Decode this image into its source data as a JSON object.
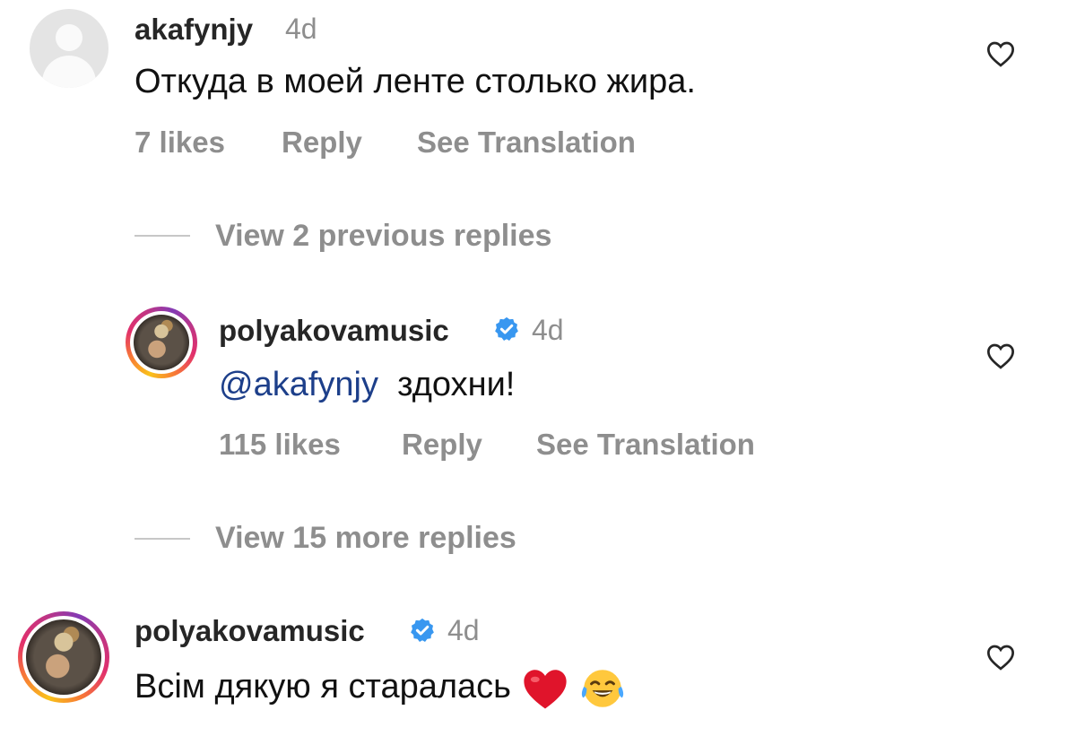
{
  "comments": [
    {
      "username": "akafynjy",
      "time": "4d",
      "text": "Откуда в моей ленте столько жира.",
      "likes": "7 likes",
      "reply": "Reply",
      "translate": "See Translation"
    },
    {
      "username": "polyakovamusic",
      "time": "4d",
      "mention": "@akafynjy",
      "text": "здохни!",
      "likes": "115 likes",
      "reply": "Reply",
      "translate": "See Translation"
    },
    {
      "username": "polyakovamusic",
      "time": "4d",
      "text": "Всім дякую я старалась",
      "emoji": [
        "red-heart",
        "tears-of-joy"
      ]
    }
  ],
  "view_previous": "View 2 previous replies",
  "view_more": "View 15 more replies",
  "colors": {
    "secondary": "#8e8e8e",
    "mention": "#1d3f8a",
    "verified": "#3897f0",
    "heart_red": "#e0142b"
  }
}
